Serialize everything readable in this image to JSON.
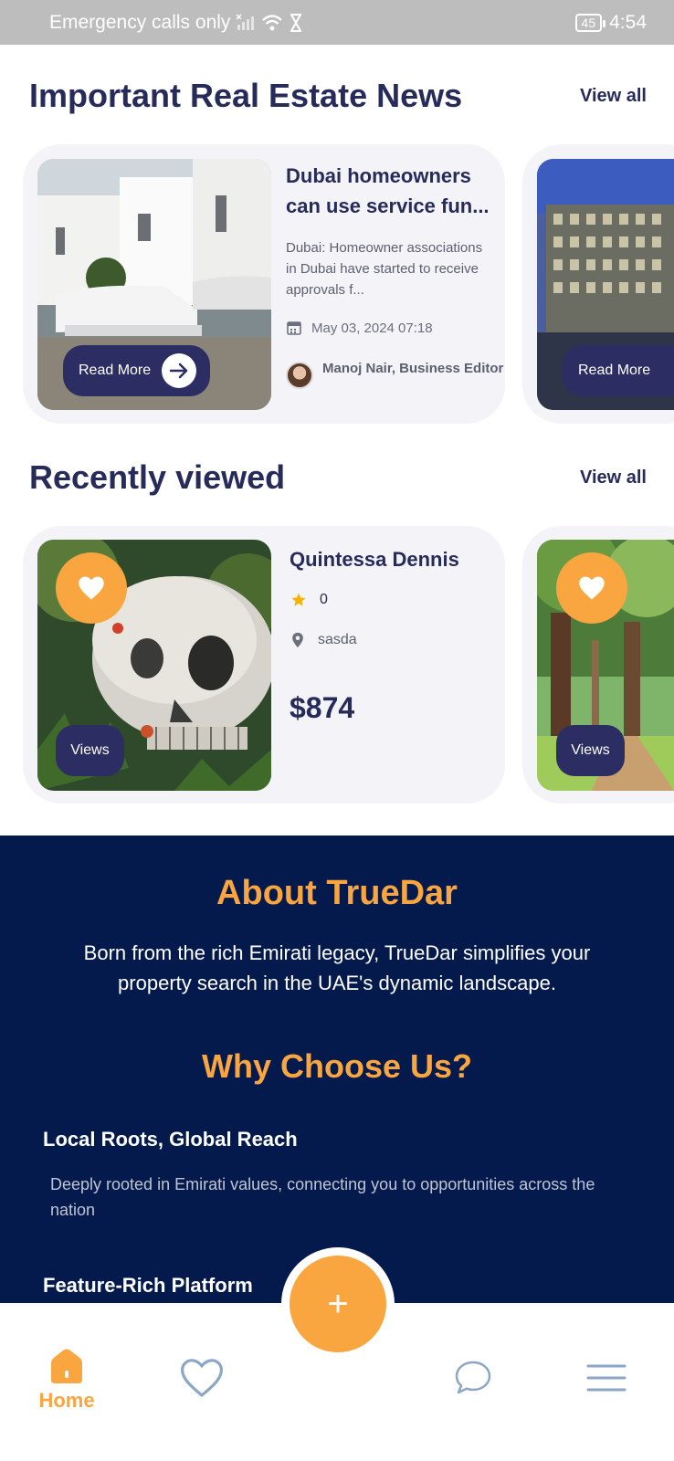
{
  "status_bar": {
    "carrier_text": "Emergency calls only",
    "battery": "45",
    "time": "4:54"
  },
  "news": {
    "title": "Important Real Estate News",
    "view_all": "View all",
    "cards": [
      {
        "headline": "Dubai homeowners can use service fun...",
        "excerpt": "Dubai: Homeowner associations in Dubai have started to receive approvals f...",
        "date": "May 03, 2024 07:18",
        "author": "Manoj Nair, Business Editor",
        "read_more": "Read More"
      },
      {
        "read_more": "Read More"
      }
    ]
  },
  "recent": {
    "title": "Recently viewed",
    "view_all": "View all",
    "cards": [
      {
        "name": "Quintessa Dennis",
        "rating": "0",
        "location": "sasda",
        "price": "$874",
        "views": "Views"
      },
      {
        "views": "Views"
      }
    ]
  },
  "about": {
    "title": "About TrueDar",
    "description": "Born from the rich Emirati legacy, TrueDar simplifies your property search in the UAE's dynamic landscape.",
    "why_title": "Why Choose Us?",
    "features": [
      {
        "title": "Local Roots, Global Reach",
        "desc": "Deeply rooted in Emirati values, connecting you to opportunities across the nation"
      },
      {
        "title": "Feature-Rich Platform"
      }
    ]
  },
  "bottom_nav": {
    "home_label": "Home",
    "fab_symbol": "+"
  },
  "colors": {
    "accent": "#f9a540",
    "navy": "#262b5a",
    "dark_section": "#051a4c",
    "button": "#2b2d63"
  }
}
